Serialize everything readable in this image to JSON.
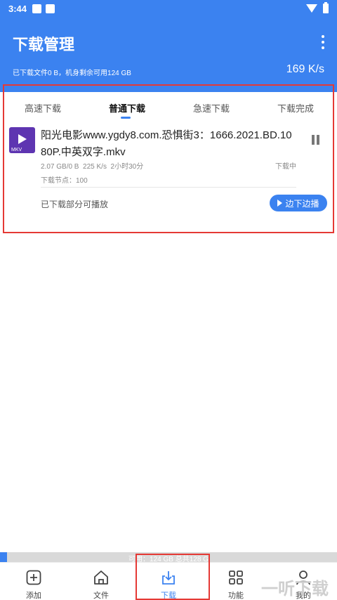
{
  "status_bar": {
    "time": "3:44"
  },
  "header": {
    "title": "下载管理",
    "storage_info": "已下载文件0 B，机身剩余可用124 GB",
    "speed": "169 K/s"
  },
  "tabs": [
    {
      "label": "高速下载"
    },
    {
      "label": "普通下载"
    },
    {
      "label": "急速下载"
    },
    {
      "label": "下载完成"
    }
  ],
  "download_item": {
    "file_type": "MKV",
    "file_name": "阳光电影www.ygdy8.com.恐惧街3：1666.2021.BD.1080P.中英双字.mkv",
    "progress_text": "2.07 GB/0 B",
    "speed": "225 K/s",
    "remaining": "2小时30分",
    "status": "下载中",
    "nodes": "下载节点：100",
    "partial_hint": "已下载部分可播放",
    "play_button": "边下边播"
  },
  "storage_bar": {
    "text": "可用：124 GB  总共128 G",
    "used_fraction": 0.02
  },
  "bottom_nav": [
    {
      "label": "添加",
      "icon": "add-icon"
    },
    {
      "label": "文件",
      "icon": "home-icon"
    },
    {
      "label": "下载",
      "icon": "download-icon"
    },
    {
      "label": "功能",
      "icon": "grid-icon"
    },
    {
      "label": "我的",
      "icon": "user-icon"
    }
  ],
  "watermark": "一听下载",
  "colors": {
    "accent": "#3b82f0",
    "highlight": "#e53935",
    "file_icon": "#5e35b1"
  }
}
